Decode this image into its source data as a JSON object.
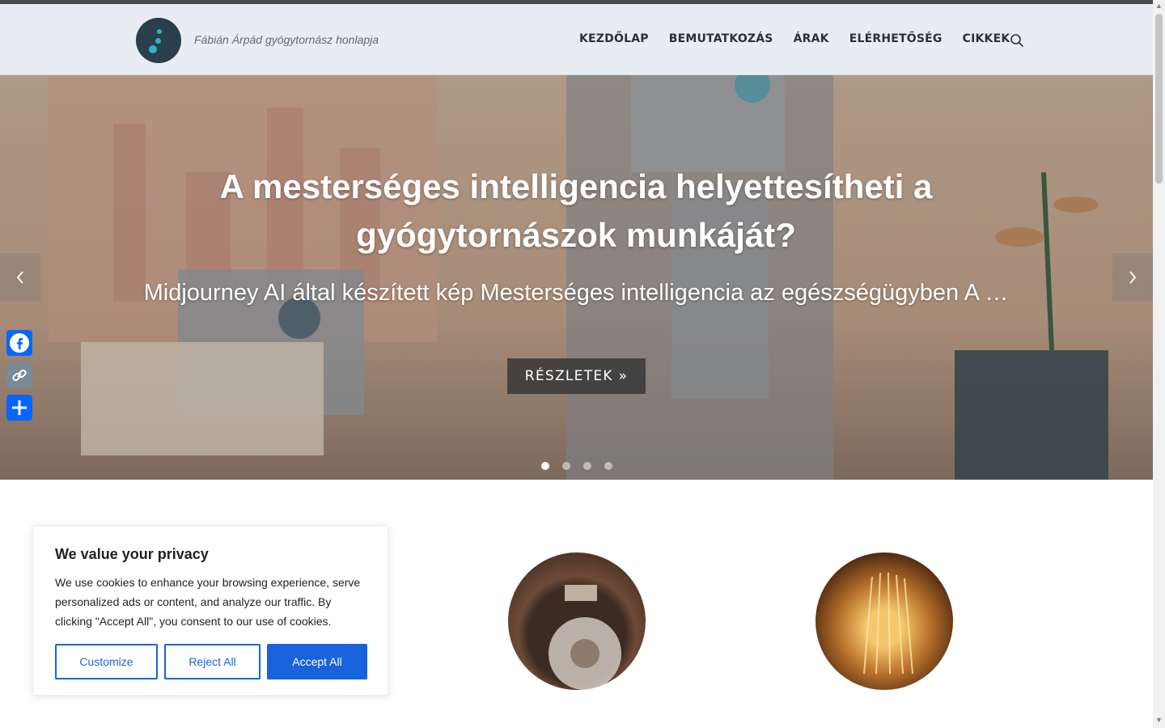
{
  "site": {
    "tagline": "Fábián Árpád gyógytornász honlapja"
  },
  "nav": {
    "items": [
      {
        "label": "KEZDŐLAP"
      },
      {
        "label": "BEMUTATKOZÁS"
      },
      {
        "label": "ÁRAK"
      },
      {
        "label": "ELÉRHETŐSÉG"
      },
      {
        "label": "CIKKEK"
      }
    ],
    "search_icon": "search-icon"
  },
  "hero": {
    "title": "A mesterséges intelligencia helyettesítheti a gyógytornászok munkáját?",
    "subtitle": "Midjourney AI által készített kép Mesterséges intelligencia az egészségügyben A …",
    "button_label": "RÉSZLETEK »",
    "slides_total": 4,
    "active_slide": 1
  },
  "share": {
    "items": [
      "facebook-icon",
      "copy-link-icon",
      "share-icon"
    ]
  },
  "cookie": {
    "title": "We value your privacy",
    "text": "We use cookies to enhance your browsing experience, serve personalized ads or content, and analyze our traffic. By clicking \"Accept All\", you consent to our use of cookies.",
    "customize": "Customize",
    "reject": "Reject All",
    "accept": "Accept All"
  },
  "colors": {
    "brand_blue": "#1863dc",
    "header_bg": "#e7edf3",
    "logo_bg": "#2a3e4b",
    "logo_accent": "#2fb3d4"
  }
}
